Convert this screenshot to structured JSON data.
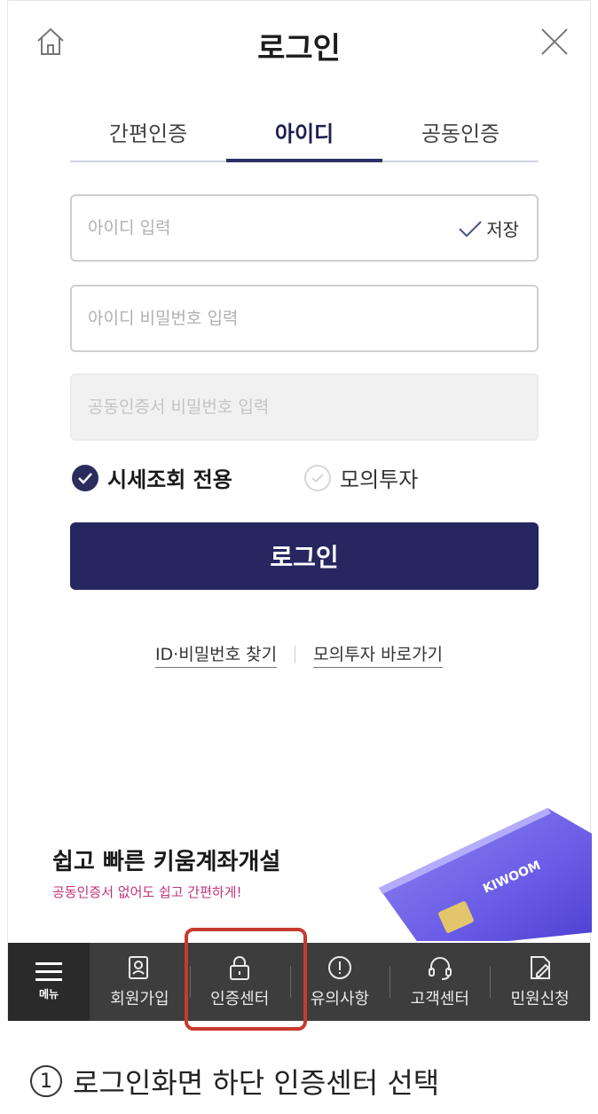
{
  "header": {
    "title": "로그인",
    "home_icon": "home-icon",
    "close_icon": "close-icon"
  },
  "tabs": [
    {
      "label": "간편인증",
      "active": false
    },
    {
      "label": "아이디",
      "active": true
    },
    {
      "label": "공동인증",
      "active": false
    }
  ],
  "form": {
    "id_placeholder": "아이디 입력",
    "save_label": "저장",
    "password_placeholder": "아이디 비밀번호 입력",
    "cert_password_placeholder": "공동인증서 비밀번호 입력"
  },
  "options": {
    "quote_only_label": "시세조회 전용",
    "quote_only_checked": true,
    "mock_invest_label": "모의투자",
    "mock_invest_checked": false
  },
  "login_button": "로그인",
  "links": {
    "find_id_pw": "ID·비밀번호 찾기",
    "mock_invest_shortcut": "모의투자 바로가기"
  },
  "promo": {
    "title": "쉽고 빠른 키움계좌개설",
    "subtitle": "공동인증서 없어도 쉽고 간편하게!",
    "card_brand": "KIWOOM"
  },
  "bottom_bar": {
    "menu_label": "메뉴",
    "items": [
      {
        "label": "회원가입",
        "icon": "signup-icon"
      },
      {
        "label": "인증센터",
        "icon": "lock-icon"
      },
      {
        "label": "유의사항",
        "icon": "alert-icon"
      },
      {
        "label": "고객센터",
        "icon": "headset-icon"
      },
      {
        "label": "민원신청",
        "icon": "edit-document-icon"
      }
    ]
  },
  "caption": {
    "number": "1",
    "text": "로그인화면 하단 인증센터 선택"
  },
  "colors": {
    "primary": "#262660",
    "highlight": "#c73b2e",
    "promo_sub": "#c2337a",
    "bottom_bar": "#3d3d3d"
  }
}
